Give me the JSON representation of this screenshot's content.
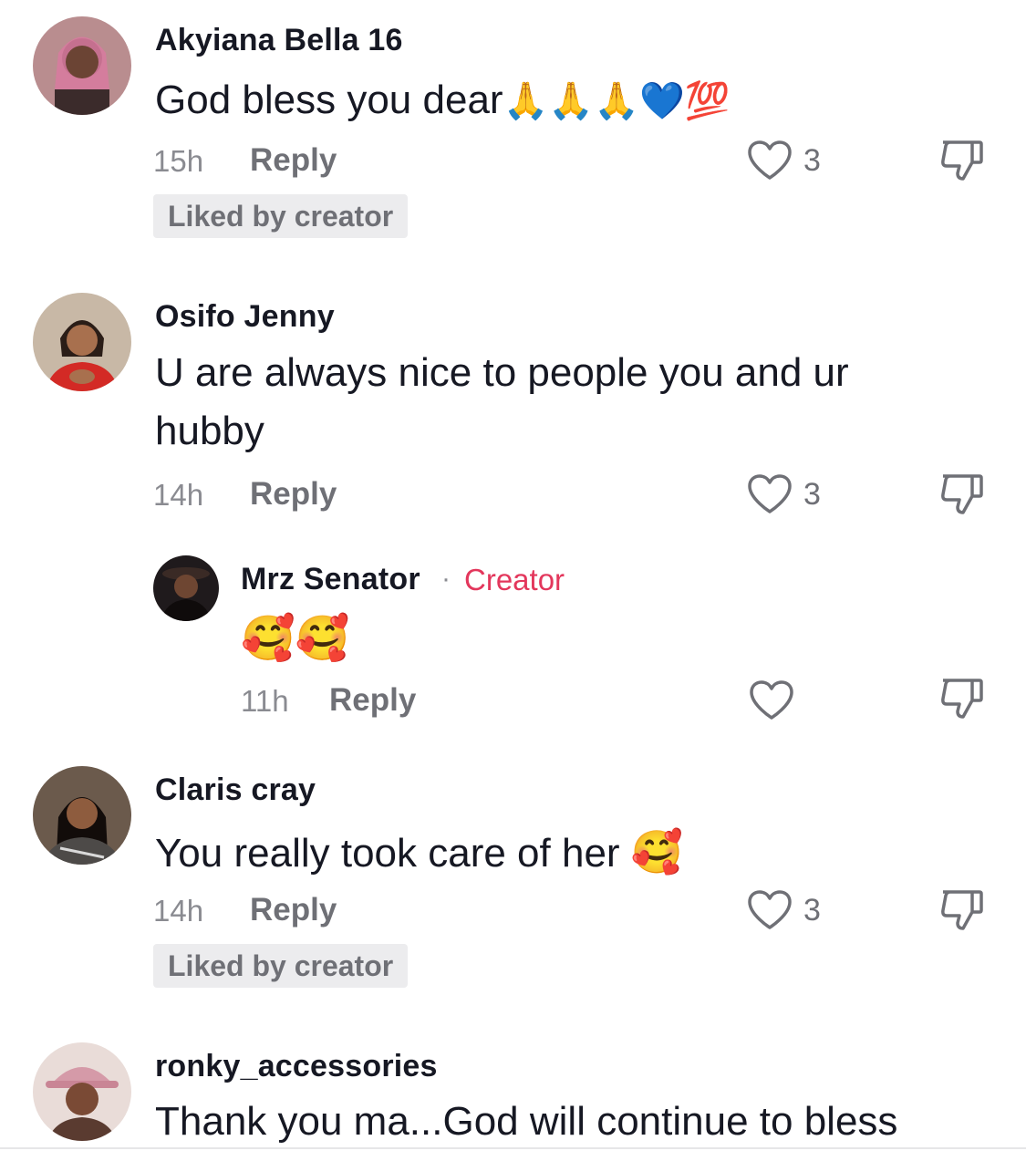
{
  "comments": [
    {
      "username": "Akyiana Bella 16",
      "text": "God bless you dear",
      "emoji": "🙏🙏🙏💙💯",
      "time": "15h",
      "reply": "Reply",
      "likes": "3",
      "liked_by_creator": "Liked by creator"
    },
    {
      "username": "Osifo Jenny",
      "text_line1": "U are always nice to people you and ur",
      "text_line2": "hubby",
      "time": "14h",
      "reply": "Reply",
      "likes": "3"
    },
    {
      "username": "Mrz Senator",
      "creator_label": "Creator",
      "separator": "·",
      "emoji": "🥰🥰",
      "time": "11h",
      "reply": "Reply"
    },
    {
      "username": "Claris cray",
      "text": "You really took care of her",
      "emoji": "🥰",
      "time": "14h",
      "reply": "Reply",
      "likes": "3",
      "liked_by_creator": "Liked by creator"
    },
    {
      "username": "ronky_accessories",
      "text": "Thank you ma...God will continue to bless"
    }
  ],
  "colors": {
    "creator_accent": "#e3375c",
    "secondary_text": "#8a8b91",
    "badge_bg": "#ececee"
  }
}
